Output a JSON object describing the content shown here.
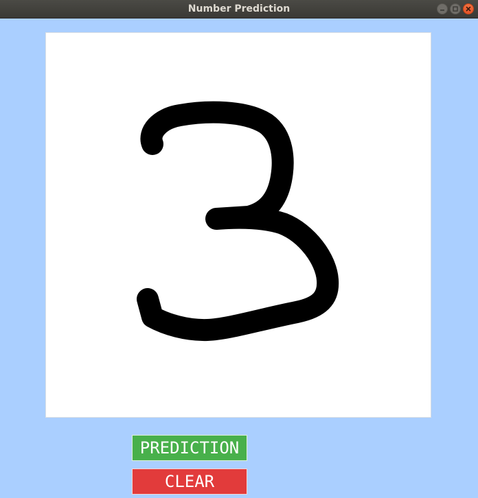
{
  "window": {
    "title": "Number Prediction",
    "controls": {
      "minimize_icon": "minimize-icon",
      "maximize_icon": "maximize-icon",
      "close_icon": "close-icon"
    }
  },
  "drawing_canvas": {
    "background": "#ffffff",
    "stroke_color": "#000000",
    "drawn_digit_icon": "handwritten-digit-3"
  },
  "buttons": {
    "prediction_label": "PREDICTION",
    "prediction_color": "#48b04b",
    "clear_label": "CLEAR",
    "clear_color": "#e23b3b"
  },
  "colors": {
    "window_background": "#aacfff",
    "titlebar": "#3f3e3a"
  }
}
